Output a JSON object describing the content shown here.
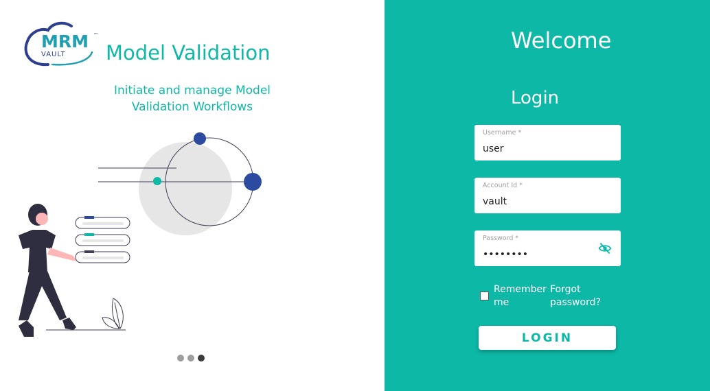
{
  "brand": {
    "logo_text": "MRM",
    "logo_sub": "VAULT",
    "logo_tm": "™",
    "app_title": "Model Validation",
    "tagline": "Initiate and manage Model Validation Workflows",
    "accent_color": "#0db8a7"
  },
  "carousel": {
    "slide_count": 3,
    "active_index": 2
  },
  "login": {
    "welcome": "Welcome",
    "heading": "Login",
    "username": {
      "label": "Username *",
      "value": "user"
    },
    "account": {
      "label": "Account Id *",
      "value": "vault"
    },
    "password": {
      "label": "Password *",
      "value": "••••••••",
      "toggle_icon": "eye-off-icon"
    },
    "remember_label": "Remember me",
    "remember_checked": false,
    "forgot_label": "Forgot password?",
    "submit_label": "LOGIN"
  }
}
